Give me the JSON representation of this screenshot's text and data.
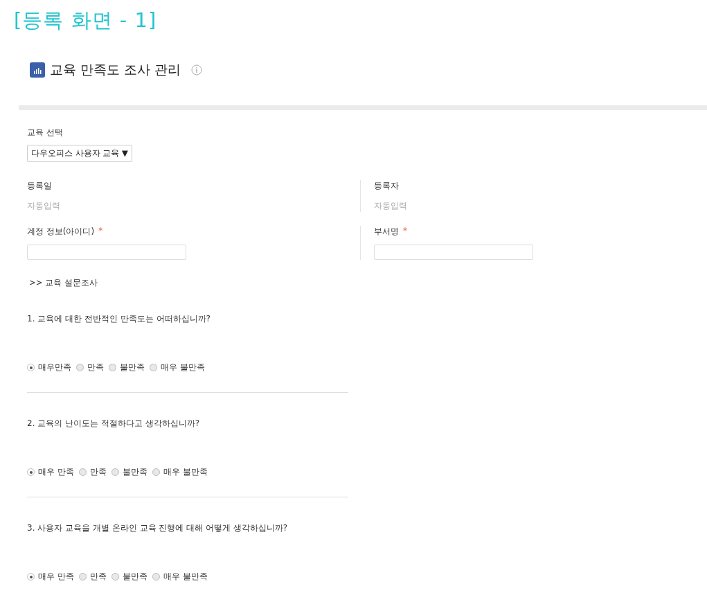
{
  "caption": "[등록 화면 - 1]",
  "page": {
    "title": "교육 만족도 조사 관리"
  },
  "course_select": {
    "label": "교육 선택",
    "value": "다우오피스 사용자 교육",
    "caret": "▼"
  },
  "fields": [
    {
      "label": "등록일",
      "value": "자동입력",
      "kind": "readonly",
      "required": false
    },
    {
      "label": "등록자",
      "value": "자동입력",
      "kind": "readonly",
      "required": false
    },
    {
      "label": "계정 정보(아이디)",
      "kind": "input",
      "required": true
    },
    {
      "label": "부서명",
      "kind": "input",
      "required": true
    }
  ],
  "required_mark": "*",
  "section_title": ">> 교육 설문조사",
  "questions": [
    {
      "text": "1. 교육에 대한 전반적인 만족도는 어떠하십니까?",
      "options": [
        {
          "label": "매우만족",
          "selected": true
        },
        {
          "label": "만족",
          "selected": false
        },
        {
          "label": "불만족",
          "selected": false
        },
        {
          "label": "매우 불만족",
          "selected": false
        }
      ]
    },
    {
      "text": "2. 교육의 난이도는 적절하다고 생각하십니까?",
      "options": [
        {
          "label": "매우 만족",
          "selected": true
        },
        {
          "label": "만족",
          "selected": false
        },
        {
          "label": "불만족",
          "selected": false
        },
        {
          "label": "매우 불만족",
          "selected": false
        }
      ]
    },
    {
      "text": "3. 사용자 교육을 개별 온라인 교육 진행에 대해 어떻게 생각하십니까?",
      "options": [
        {
          "label": "매우 만족",
          "selected": true
        },
        {
          "label": "만족",
          "selected": false
        },
        {
          "label": "불만족",
          "selected": false
        },
        {
          "label": "매우 불만족",
          "selected": false
        }
      ]
    }
  ]
}
